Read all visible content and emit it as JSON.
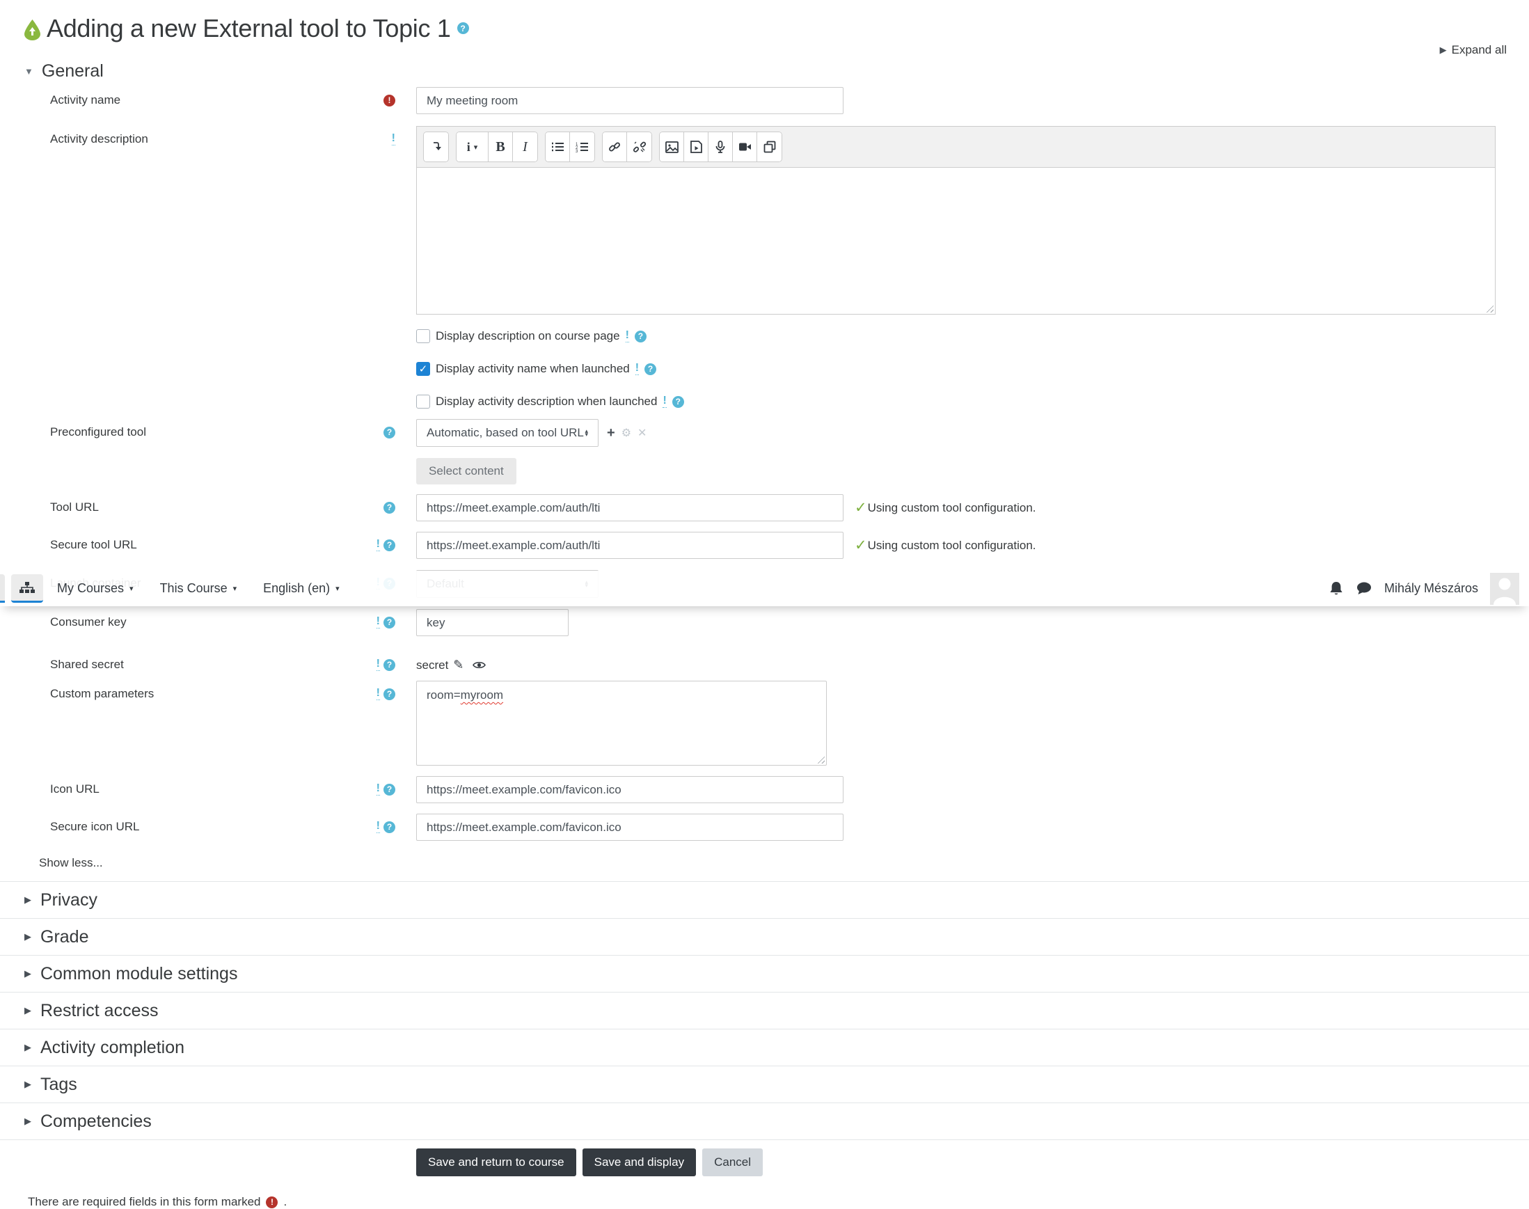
{
  "page": {
    "title": "Adding a new External tool to Topic 1",
    "expand_all": "Expand all",
    "required_note": "There are required fields in this form marked",
    "required_note_suffix": "."
  },
  "navbar": {
    "items": [
      "My Courses",
      "This Course",
      "English (en)"
    ],
    "user_name": "Mihály Mészáros"
  },
  "sections": {
    "general": "General",
    "collapsed": [
      "Privacy",
      "Grade",
      "Common module settings",
      "Restrict access",
      "Activity completion",
      "Tags",
      "Competencies"
    ]
  },
  "form": {
    "activity_name": {
      "label": "Activity name",
      "value": "My meeting room"
    },
    "activity_description": {
      "label": "Activity description"
    },
    "checkboxes": [
      {
        "label": "Display description on course page",
        "checked": false
      },
      {
        "label": "Display activity name when launched",
        "checked": true
      },
      {
        "label": "Display activity description when launched",
        "checked": false
      }
    ],
    "preconfigured_tool": {
      "label": "Preconfigured tool",
      "value": "Automatic, based on tool URL",
      "select_content": "Select content"
    },
    "tool_url": {
      "label": "Tool URL",
      "value": "https://meet.example.com/auth/lti",
      "status": "Using custom tool configuration."
    },
    "secure_tool_url": {
      "label": "Secure tool URL",
      "value": "https://meet.example.com/auth/lti",
      "status": "Using custom tool configuration."
    },
    "launch_container": {
      "label": "Launch container",
      "value": "Default"
    },
    "consumer_key": {
      "label": "Consumer key",
      "value": "key"
    },
    "shared_secret": {
      "label": "Shared secret",
      "value": "secret"
    },
    "custom_parameters": {
      "label": "Custom parameters",
      "value_prefix": "room=",
      "misspelled": "myroom"
    },
    "icon_url": {
      "label": "Icon URL",
      "value": "https://meet.example.com/favicon.ico"
    },
    "secure_icon_url": {
      "label": "Secure icon URL",
      "value": "https://meet.example.com/favicon.ico"
    },
    "show_less": "Show less..."
  },
  "buttons": {
    "save_return": "Save and return to course",
    "save_display": "Save and display",
    "cancel": "Cancel"
  },
  "editor_toolbar": {
    "style_letter": "i",
    "bold_letter": "B",
    "italic_letter": "I"
  },
  "icons": {
    "help_glyph": "?",
    "required_glyph": "!",
    "warning_glyph": "!",
    "check_glyph": "✓",
    "checkbox_check": "✓",
    "pencil_glyph": "✎",
    "collapse_triangle": "▼",
    "expand_triangle": "▶",
    "caret_down": "▾",
    "plus_glyph": "+",
    "gear_glyph": "⚙",
    "x_glyph": "✕"
  },
  "colors": {
    "primary_blue": "#1d83d4",
    "help_blue": "#56b7d6",
    "required_red": "#b5332b",
    "success_green": "#7db03f",
    "dark_button": "#343a40",
    "activity_icon_green": "#8ab83f"
  }
}
